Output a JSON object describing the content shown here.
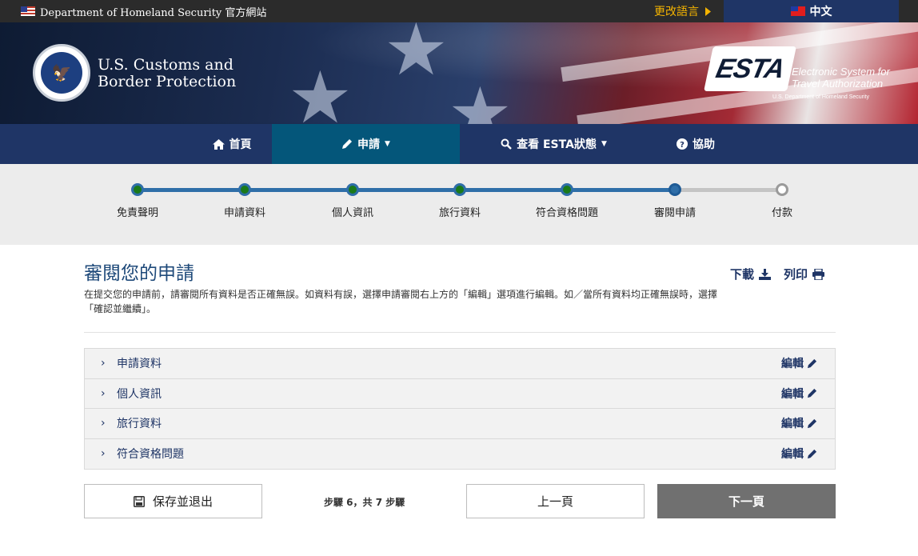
{
  "topbar": {
    "site_label": "Department of Homeland Security 官方網站",
    "change_language": "更改語言",
    "current_language": "中文"
  },
  "header": {
    "agency_line1": "U.S. Customs and",
    "agency_line2": "Border Protection",
    "esta_mark": "ESTA",
    "esta_line1": "Electronic System for",
    "esta_line2": "Travel Authorization",
    "esta_sub": "U.S. Department of Homeland Security"
  },
  "nav": {
    "items": [
      {
        "label": "首頁",
        "icon": "home-icon"
      },
      {
        "label": "申請",
        "icon": "pencil-icon",
        "dropdown": true,
        "active": true
      },
      {
        "label": "查看 ESTA狀態",
        "icon": "search-icon",
        "dropdown": true
      },
      {
        "label": "協助",
        "icon": "question-circle-icon"
      }
    ]
  },
  "progress": {
    "steps": [
      {
        "label": "免責聲明",
        "state": "done"
      },
      {
        "label": "申請資料",
        "state": "done"
      },
      {
        "label": "個人資訊",
        "state": "done"
      },
      {
        "label": "旅行資料",
        "state": "done"
      },
      {
        "label": "符合資格問題",
        "state": "done"
      },
      {
        "label": "審閱申請",
        "state": "current"
      },
      {
        "label": "付款",
        "state": "future"
      }
    ],
    "colors": {
      "done": "#1a7a1a",
      "line": "#2f6ea8",
      "future": "#9a9a9a"
    }
  },
  "main": {
    "title": "審閱您的申請",
    "download_label": "下載",
    "print_label": "列印",
    "intro": "在提交您的申請前，請審閱所有資料是否正確無誤。如資料有誤，選擇申請審閱右上方的「編輯」選項進行編輯。如／當所有資料均正確無誤時，選擇「確認並繼續」。",
    "sections": [
      {
        "title": "申請資料",
        "edit": "編輯"
      },
      {
        "title": "個人資訊",
        "edit": "編輯"
      },
      {
        "title": "旅行資料",
        "edit": "編輯"
      },
      {
        "title": "符合資格問題",
        "edit": "編輯"
      }
    ]
  },
  "footer_actions": {
    "save_exit": "保存並退出",
    "step_count": "步驟 6，共 7 步驟",
    "prev": "上一頁",
    "next": "下一頁"
  }
}
